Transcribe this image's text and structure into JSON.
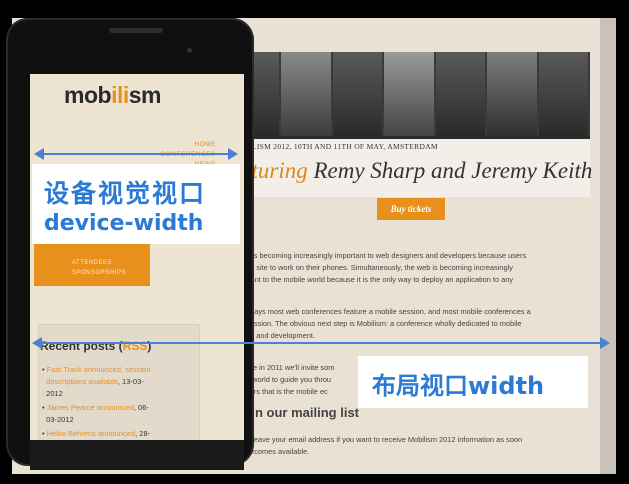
{
  "annotations": {
    "device_viewport_line1": "设备视觉视口",
    "device_viewport_line2": "device-width",
    "layout_viewport": "布局视口width",
    "accent_color": "#2b7ad6"
  },
  "site": {
    "conference_line": "LISM 2012, 10TH AND 11TH OF MAY, AMSTERDAM",
    "featuring": "aturing",
    "speakers": " Remy Sharp and Jeremy Keith",
    "buy_button": "Buy tickets",
    "para1": [
      "e is becoming increasingly important to web designers and developers because users",
      "t a site to work on their phones. Simultaneously, the web is becoming increasingly",
      "rtant to the mobile world because it is the only way to deploy an application to any"
    ],
    "para2": [
      "adays most web conferences feature a mobile session, and most mobile conferences a",
      "session. The obvious next step is Mobilism: a conference wholly dedicated to mobile",
      "gn and development."
    ],
    "para3": [
      "like in 2011 we'll invite som",
      "e world to guide you throu",
      "sers that is the mobile ec"
    ],
    "mailing_head": "n our mailing list",
    "para4": [
      "e leave your email address if you want to receive Mobilism 2012 information as soon",
      "becomes available."
    ],
    "brand_color": "#e8901c"
  },
  "phone": {
    "logo_start": "mob",
    "logo_mid": "ili",
    "logo_end": "sm",
    "nav": [
      "HOME",
      "CONFERENCES",
      "NEWS"
    ],
    "orange_items": [
      "ATTENDEES",
      "SPONSORSHIPS"
    ],
    "recent_title": "Recent posts (",
    "recent_rss": "RSS",
    "recent_close": ")",
    "posts": [
      {
        "link": "Fast Track announced, session",
        "link2": "descriptions available",
        "date": ", 13-03-",
        "date2": "2012"
      },
      {
        "link": "James Pearce announced",
        "date": ", 06-",
        "date2": "03-2012"
      },
      {
        "link": "Heiko Behrens announced",
        "date": ", 28-"
      }
    ]
  }
}
